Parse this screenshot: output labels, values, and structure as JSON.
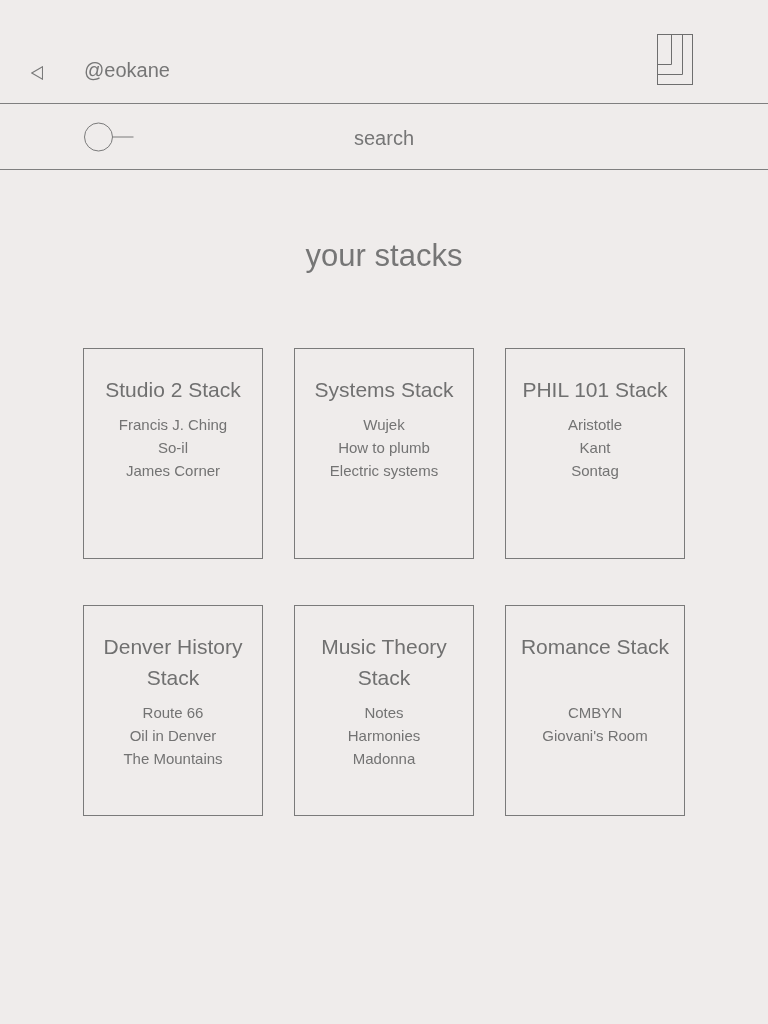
{
  "header": {
    "username": "@eokane"
  },
  "search": {
    "placeholder": "search"
  },
  "heading": "your stacks",
  "stacks": [
    {
      "title": "Studio 2 Stack",
      "items": [
        "Francis J. Ching",
        "So-il",
        "James Corner"
      ]
    },
    {
      "title": "Systems Stack",
      "items": [
        "Wujek",
        "How to plumb",
        "Electric systems"
      ]
    },
    {
      "title": "PHIL 101 Stack",
      "items": [
        "Aristotle",
        "Kant",
        "Sontag"
      ]
    },
    {
      "title": "Denver History Stack",
      "items": [
        "Route 66",
        "Oil in Denver",
        "The Mountains"
      ]
    },
    {
      "title": "Music Theory Stack",
      "items": [
        "Notes",
        "Harmonies",
        "Madonna"
      ]
    },
    {
      "title": "Romance Stack",
      "items": [
        "CMBYN",
        "Giovani's Room"
      ]
    }
  ]
}
